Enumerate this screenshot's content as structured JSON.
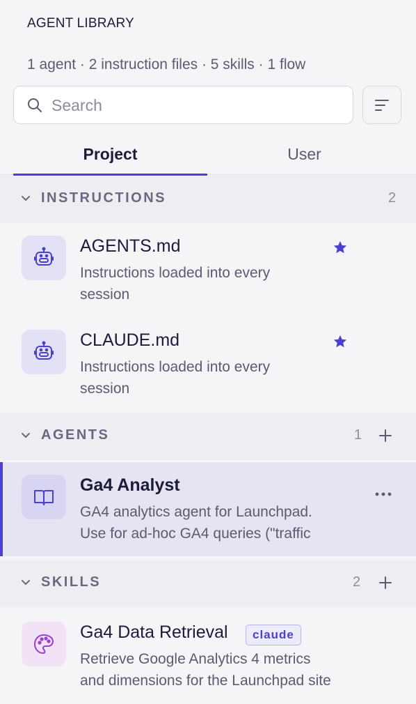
{
  "header": {
    "title": "AGENT LIBRARY",
    "summary": "1 agent · 2 instruction files · 5 skills · 1 flow"
  },
  "search": {
    "placeholder": "Search"
  },
  "tabs": [
    {
      "label": "Project",
      "active": true
    },
    {
      "label": "User",
      "active": false
    }
  ],
  "sections": {
    "instructions": {
      "label": "INSTRUCTIONS",
      "count": "2",
      "items": [
        {
          "name": "AGENTS.md",
          "desc_line1": "Instructions loaded into every",
          "desc_line2": "session",
          "icon": "robot-icon",
          "starred": true
        },
        {
          "name": "CLAUDE.md",
          "desc_line1": "Instructions loaded into every",
          "desc_line2": "session",
          "icon": "robot-icon",
          "starred": true
        }
      ]
    },
    "agents": {
      "label": "AGENTS",
      "count": "1",
      "items": [
        {
          "name": "Ga4 Analyst",
          "desc_line1": "GA4 analytics agent for Launchpad.",
          "desc_line2": "Use for ad-hoc GA4 queries (\"traffic",
          "icon": "book-icon",
          "selected": true
        }
      ]
    },
    "skills": {
      "label": "SKILLS",
      "count": "2",
      "items": [
        {
          "name": "Ga4 Data Retrieval",
          "tag": "claude",
          "desc_line1": "Retrieve Google Analytics 4 metrics",
          "desc_line2": "and dimensions for the Launchpad site",
          "icon": "palette-icon"
        }
      ]
    }
  },
  "colors": {
    "accent": "#4b3fcf",
    "background": "#f5f5f8",
    "section_background": "#eeeef2",
    "selected_background": "#e5e4f2"
  }
}
